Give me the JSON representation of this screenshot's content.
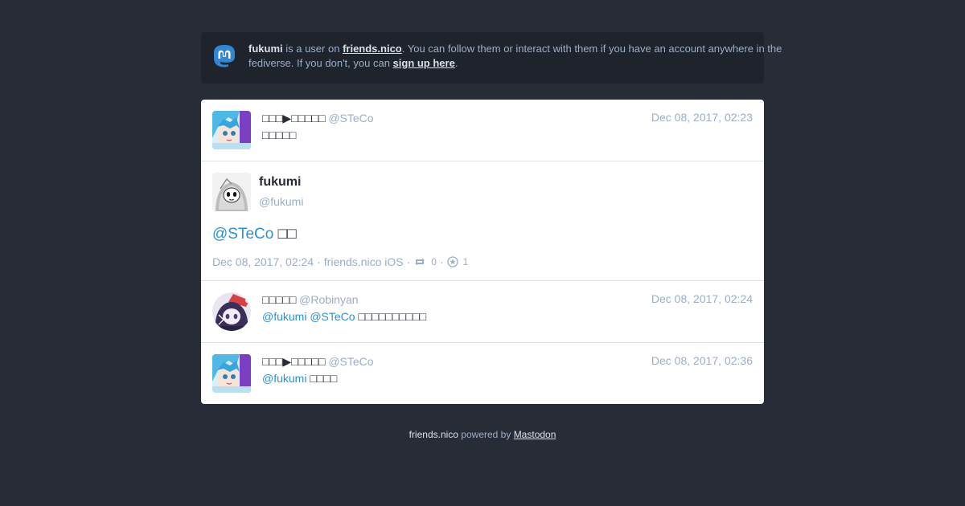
{
  "banner": {
    "username": "fukumi",
    "text_1": " is a user on ",
    "instance_link": "friends.nico",
    "text_2": ". You can follow them or interact with them if you have an account anywhere in the fediverse. If you don't, you can ",
    "signup_link": "sign up here",
    "text_3": "."
  },
  "statuses": [
    {
      "display_name": "□□□▶□□□□□",
      "acct": "@STeCo",
      "time": "Dec 08, 2017, 02:23",
      "content": "□□□□□"
    },
    {
      "display_name": "□□□□□",
      "acct": "@Robinyan",
      "time": "Dec 08, 2017, 02:24",
      "mention_1": "@fukumi",
      "mention_2": "@STeCo",
      "content": "□□□□□□□□□□"
    },
    {
      "display_name": "□□□▶□□□□□",
      "acct": "@STeCo",
      "time": "Dec 08, 2017, 02:36",
      "mention_1": "@fukumi",
      "content": "□□□□"
    }
  ],
  "detail": {
    "display_name": "fukumi",
    "acct": "@fukumi",
    "mention": "@STeCo",
    "content": "□□",
    "time": "Dec 08, 2017, 02:24",
    "separator": "·",
    "app": "friends.nico iOS",
    "reblogs": "0",
    "favourites": "1"
  },
  "footer": {
    "instance": "friends.nico",
    "powered_by": " powered by ",
    "mastodon_link": "Mastodon"
  },
  "colors": {
    "background": "#282c37",
    "banner_bg": "#1f232b",
    "secondary_text": "#9baec8",
    "mention": "#2b90d9",
    "logo": "#3088d4"
  },
  "icons": {
    "logo": "mastodon-logo-icon",
    "reblog": "retweet-icon",
    "favourite": "star-icon"
  }
}
